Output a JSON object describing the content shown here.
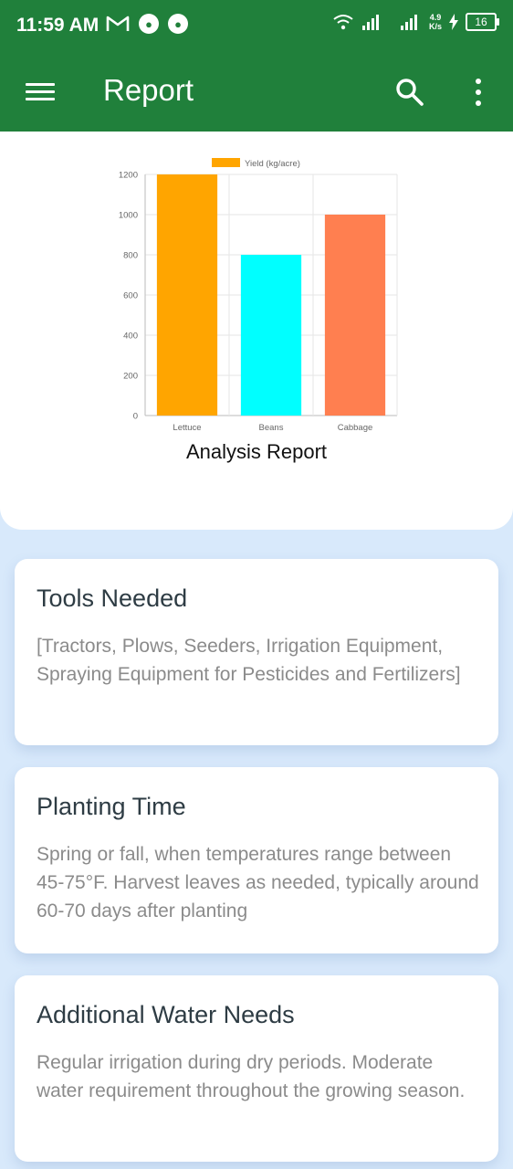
{
  "status_bar": {
    "time": "11:59 AM",
    "net_speed_value": "4.9",
    "net_speed_unit": "K/s",
    "battery": "16"
  },
  "app_bar": {
    "title": "Report",
    "icons": [
      "menu-icon",
      "search-icon",
      "more-vert-icon"
    ]
  },
  "colors": {
    "app_bar": "#20803b",
    "background": "#d8e9fb"
  },
  "chart_data": {
    "type": "bar",
    "categories": [
      "Lettuce",
      "Beans",
      "Cabbage"
    ],
    "series": [
      {
        "name": "Yield (kg/acre)",
        "values": [
          1200,
          800,
          1000
        ]
      }
    ],
    "bar_colors": [
      "#ffa500",
      "#00ffff",
      "#ff7f50"
    ],
    "legend_color": "#ffa500",
    "ylim": [
      0,
      1200
    ],
    "yticks": [
      0,
      200,
      400,
      600,
      800,
      1000,
      1200
    ],
    "grid": true,
    "legend": "top",
    "caption": "Analysis Report"
  },
  "cards": [
    {
      "title": "Tools Needed",
      "body": "[Tractors, Plows, Seeders, Irrigation Equipment, Spraying Equipment for Pesticides and Fertilizers]"
    },
    {
      "title": "Planting Time",
      "body": "Spring or fall, when temperatures range between 45-75°F. Harvest leaves as needed, typically around 60-70 days after planting"
    },
    {
      "title": "Additional Water Needs",
      "body": "Regular irrigation during dry periods. Moderate water requirement throughout the growing season."
    }
  ]
}
